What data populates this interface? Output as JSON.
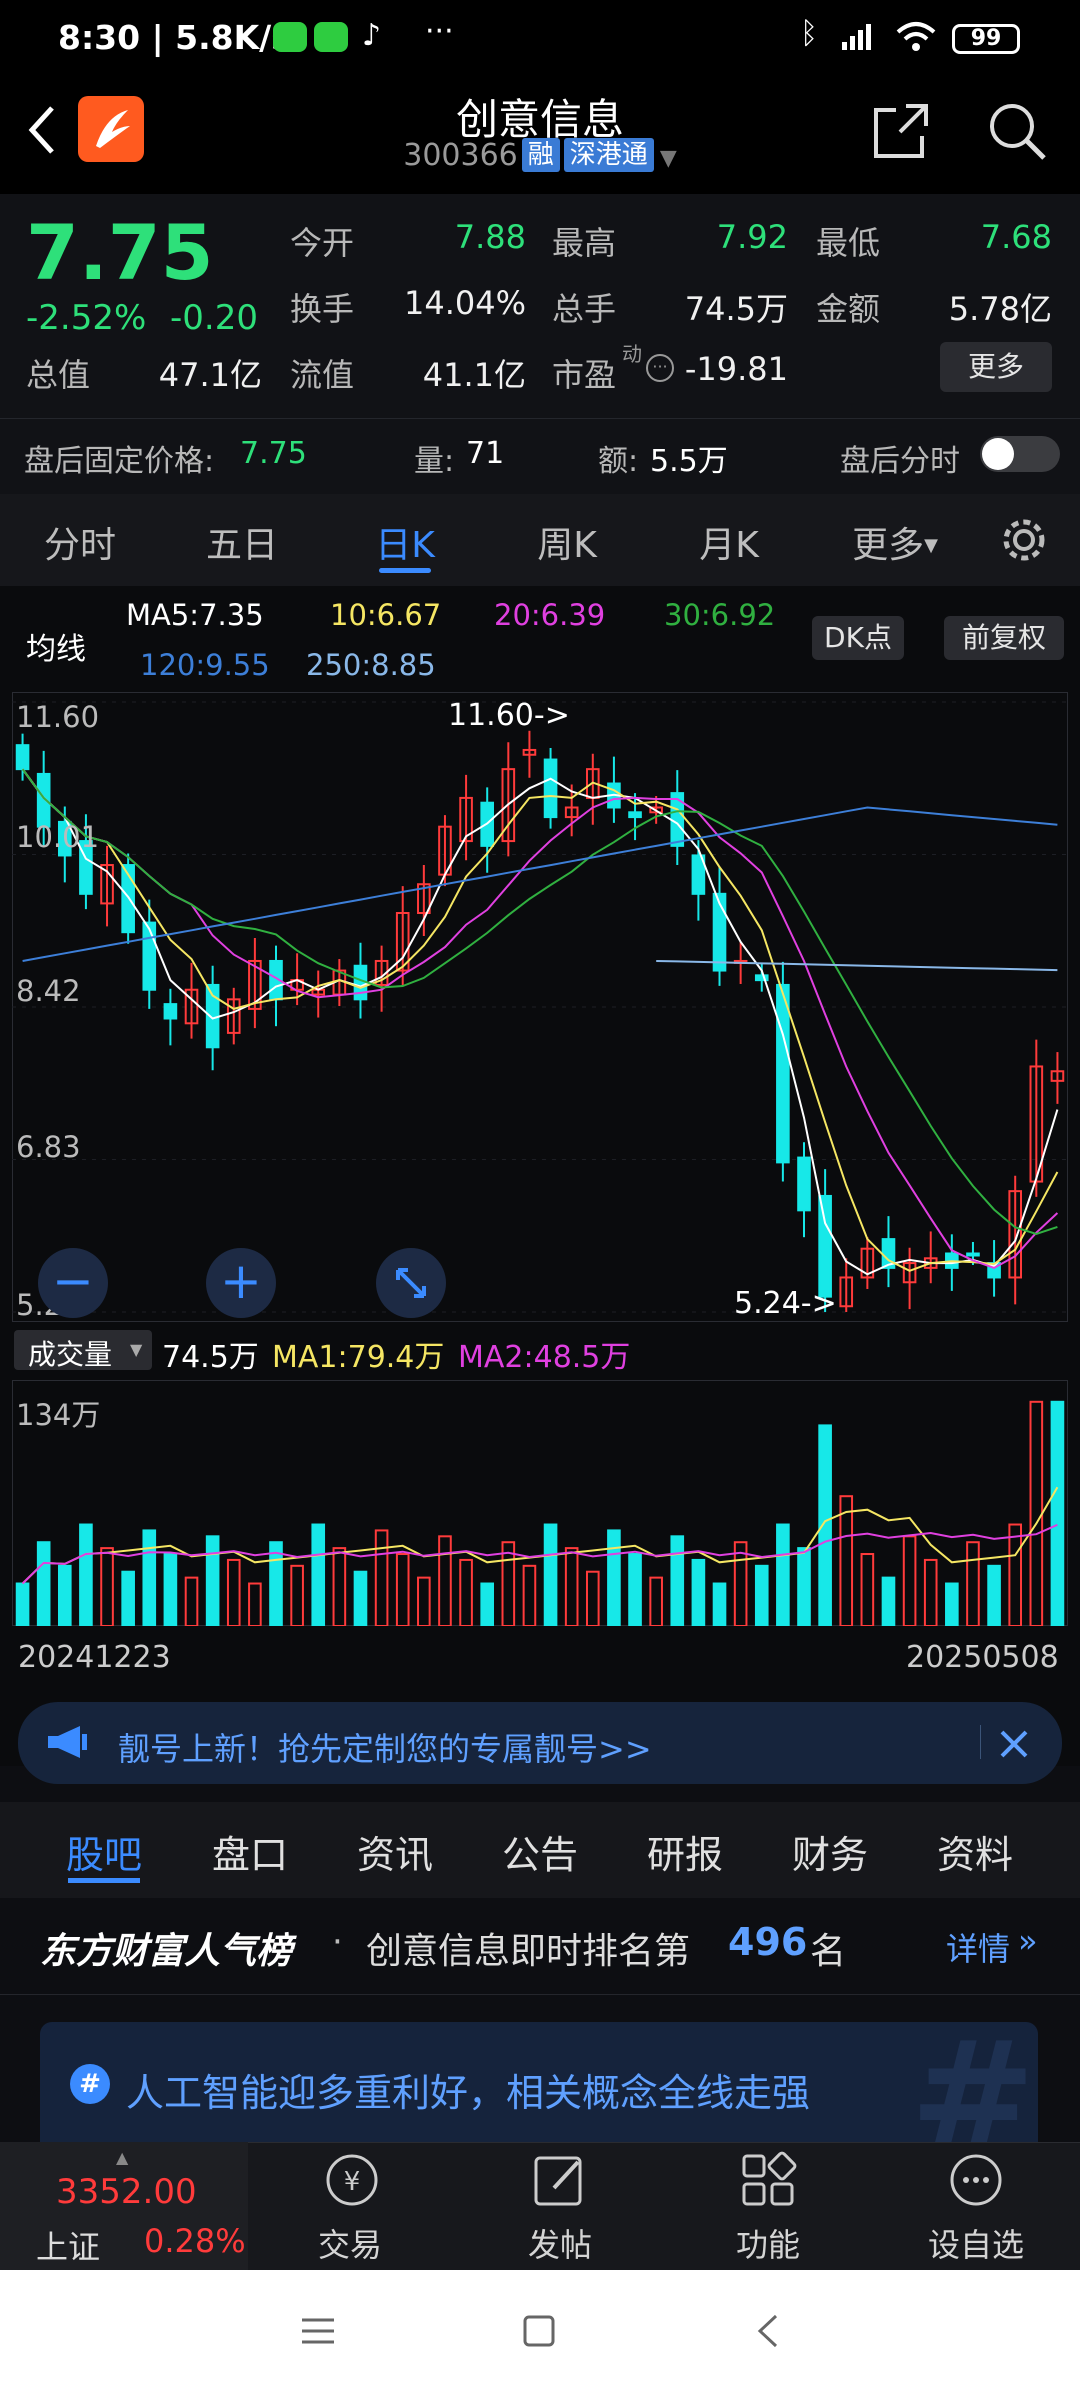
{
  "status_bar": {
    "time": "8:30 | 5.8K/s",
    "dots": "···",
    "battery": "99"
  },
  "header": {
    "title": "创意信息",
    "code": "300366",
    "tag_margin": "融",
    "tag_connect": "深港通"
  },
  "quote": {
    "price": "7.75",
    "change_pct": "-2.52%",
    "change": "-0.20",
    "open_label": "今开",
    "open": "7.88",
    "high_label": "最高",
    "high": "7.92",
    "low_label": "最低",
    "low": "7.68",
    "turnover_label": "换手",
    "turnover": "14.04%",
    "volume_label": "总手",
    "volume": "74.5万",
    "amount_label": "金额",
    "amount": "5.78亿",
    "total_cap_label": "总值",
    "total_cap": "47.1亿",
    "float_cap_label": "流值",
    "float_cap": "41.1亿",
    "pe_label": "市盈",
    "pe_sup": "动",
    "pe": "-19.81",
    "more_button": "更多"
  },
  "after_hours": {
    "price_label": "盘后固定价格:",
    "price": "7.75",
    "vol_label": "量:",
    "vol": "71",
    "amt_label": "额:",
    "amt": "5.5万",
    "intraday_label": "盘后分时"
  },
  "chart_tabs": [
    "分时",
    "五日",
    "日K",
    "周K",
    "月K",
    "更多"
  ],
  "ma": {
    "label": "均线",
    "ma5": "MA5:7.35",
    "ma10": "10:6.67",
    "ma20": "20:6.39",
    "ma30": "30:6.92",
    "ma120": "120:9.55",
    "ma250": "250:8.85",
    "dk_button": "DK点",
    "adjust_button": "前复权"
  },
  "price_axis": [
    "11.60",
    "10.01",
    "8.42",
    "6.83",
    "5.24"
  ],
  "annotations": {
    "high": "11.60->",
    "low": "5.24->"
  },
  "volume": {
    "selector": "成交量",
    "value": "74.5万",
    "ma1": "MA1:79.4万",
    "ma2": "MA2:48.5万",
    "axis_top": "134万"
  },
  "dates": {
    "start": "20241223",
    "end": "20250508"
  },
  "banner": {
    "text": "靓号上新！抢先定制您的专属靓号>>"
  },
  "bottom_tabs": [
    "股吧",
    "盘口",
    "资讯",
    "公告",
    "研报",
    "财务",
    "资料"
  ],
  "popularity": {
    "brand": "东方财富人气榜",
    "dot": "·",
    "text": "创意信息即时排名第",
    "rank": "496",
    "unit": "名",
    "link": "详情"
  },
  "topic": {
    "icon": "#",
    "text": "人工智能迎多重利好，相关概念全线走强"
  },
  "index": {
    "value": "3352.00",
    "name": "上证",
    "pct": "0.28%"
  },
  "nav": [
    "交易",
    "发帖",
    "功能",
    "设自选"
  ],
  "colors": {
    "up": "#ff3b3b",
    "down": "#17e8e8",
    "accent": "#3b8bff",
    "green": "#2ee07a"
  },
  "chart_data": {
    "type": "candlestick",
    "price_ticks": [
      11.6,
      10.01,
      8.42,
      6.83,
      5.24
    ],
    "ylim": [
      5.24,
      11.6
    ],
    "x_range": [
      "20241223",
      "20250508"
    ],
    "close_series": [
      10.9,
      10.3,
      10.0,
      9.6,
      9.9,
      9.2,
      8.6,
      8.3,
      8.6,
      8.0,
      8.5,
      8.9,
      8.5,
      8.7,
      8.6,
      8.8,
      8.5,
      8.9,
      9.4,
      9.7,
      10.3,
      10.6,
      10.1,
      10.9,
      11.1,
      10.4,
      10.5,
      10.9,
      10.5,
      10.4,
      10.5,
      10.1,
      9.6,
      8.8,
      8.9,
      8.7,
      6.8,
      6.3,
      5.4,
      5.6,
      5.9,
      5.7,
      5.75,
      5.8,
      5.7,
      5.85,
      5.6,
      6.5,
      7.8,
      7.75
    ],
    "ma_series": [
      {
        "name": "MA5",
        "color": "#ffffff"
      },
      {
        "name": "MA10",
        "color": "#f5e663"
      },
      {
        "name": "MA20",
        "color": "#e040e0"
      },
      {
        "name": "MA30",
        "color": "#30b040"
      },
      {
        "name": "MA120",
        "color": "#3d7fd8"
      },
      {
        "name": "MA250",
        "color": "#8ab8e8"
      }
    ]
  }
}
